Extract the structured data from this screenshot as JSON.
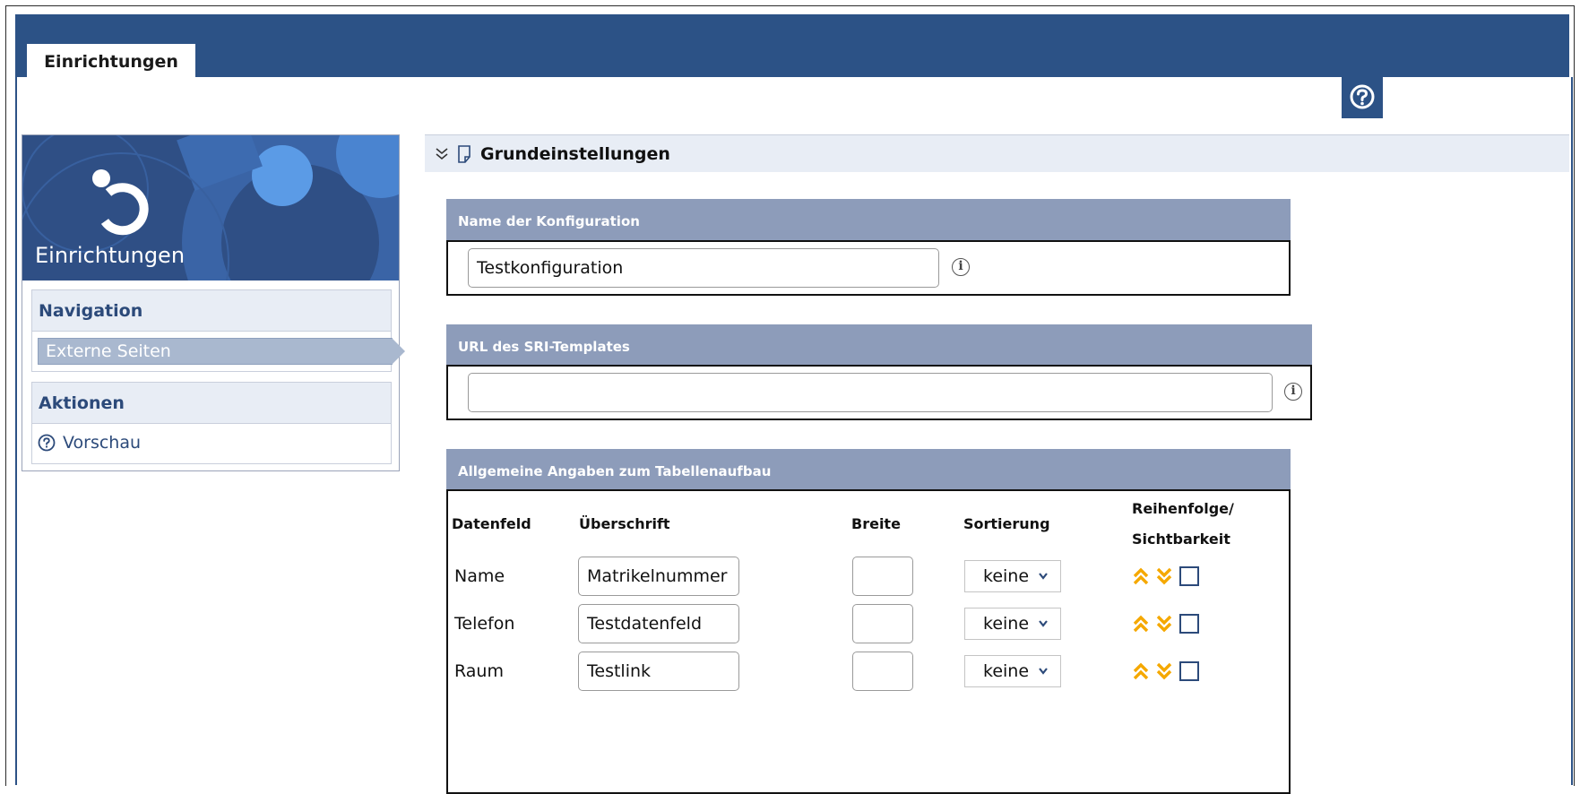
{
  "tabs": [
    {
      "label": "Einrichtungen",
      "active": true
    }
  ],
  "help": {
    "icon": "help-circle-icon"
  },
  "sidebar": {
    "title": "Einrichtungen",
    "navigation": {
      "heading": "Navigation",
      "items": [
        {
          "label": "Externe Seiten",
          "active": true
        }
      ]
    },
    "actions": {
      "heading": "Aktionen",
      "items": [
        {
          "label": "Vorschau",
          "icon": "help-circle-icon"
        }
      ]
    }
  },
  "section": {
    "title": "Grundeinstellungen",
    "expanded": true
  },
  "config_name": {
    "label": "Name der Konfiguration",
    "value": "Testkonfiguration"
  },
  "sri_url": {
    "label": "URL des SRI-Templates",
    "value": ""
  },
  "table_setup": {
    "label": "Allgemeine Angaben zum Tabellenaufbau",
    "columns": [
      "Datenfeld",
      "Überschrift",
      "Breite",
      "Sortierung",
      "Reihenfolge/",
      "Sichtbarkeit"
    ],
    "rows": [
      {
        "field": "Name",
        "heading": "Matrikelnummer",
        "width": "",
        "sort": "keine",
        "visible": false
      },
      {
        "field": "Telefon",
        "heading": "Testdatenfeld",
        "width": "",
        "sort": "keine",
        "visible": false
      },
      {
        "field": "Raum",
        "heading": "Testlink",
        "width": "",
        "sort": "keine",
        "visible": false
      }
    ]
  },
  "colors": {
    "brand": "#2c5286",
    "box_header": "#8d9cba",
    "arrow_accent": "#f5a800",
    "nav_active": "#a9b8cf"
  }
}
